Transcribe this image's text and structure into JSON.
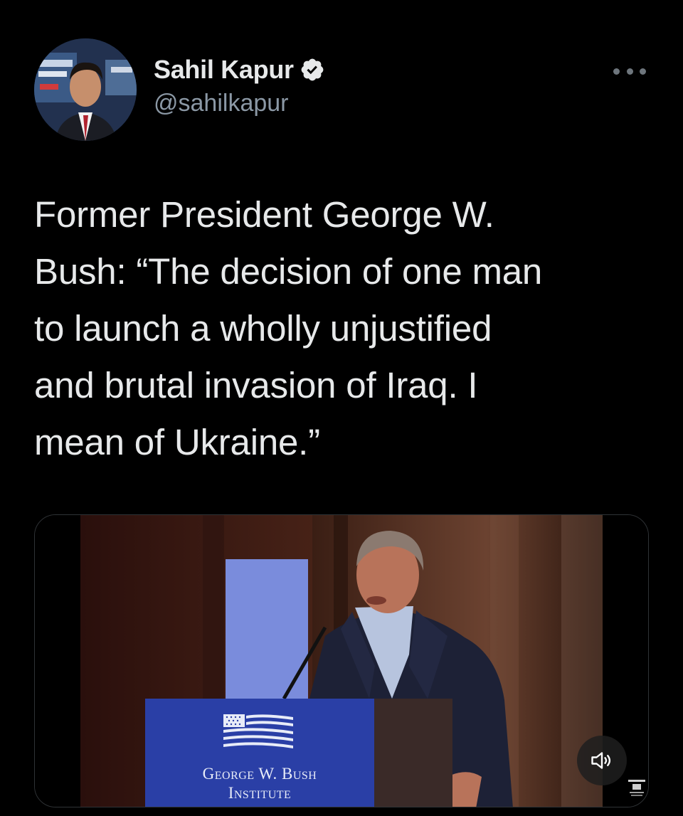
{
  "author": {
    "display_name": "Sahil Kapur",
    "handle": "@sahilkapur",
    "verified": true,
    "avatar_icon": "profile-photo"
  },
  "tweet": {
    "lines": [
      "Former President George W.",
      "Bush: “The decision of one man",
      "to launch a wholly unjustified",
      "and brutal invasion of Iraq. I",
      "mean of Ukraine.”"
    ]
  },
  "media": {
    "type": "video",
    "podium_sign": {
      "line1": "George W. Bush",
      "line2": "Institute"
    },
    "sound_icon": "speaker-muted-icon"
  },
  "colors": {
    "background": "#000000",
    "text_primary": "#e7e9ea",
    "text_secondary": "#8b98a5",
    "podium_blue": "#2a3fa6"
  }
}
